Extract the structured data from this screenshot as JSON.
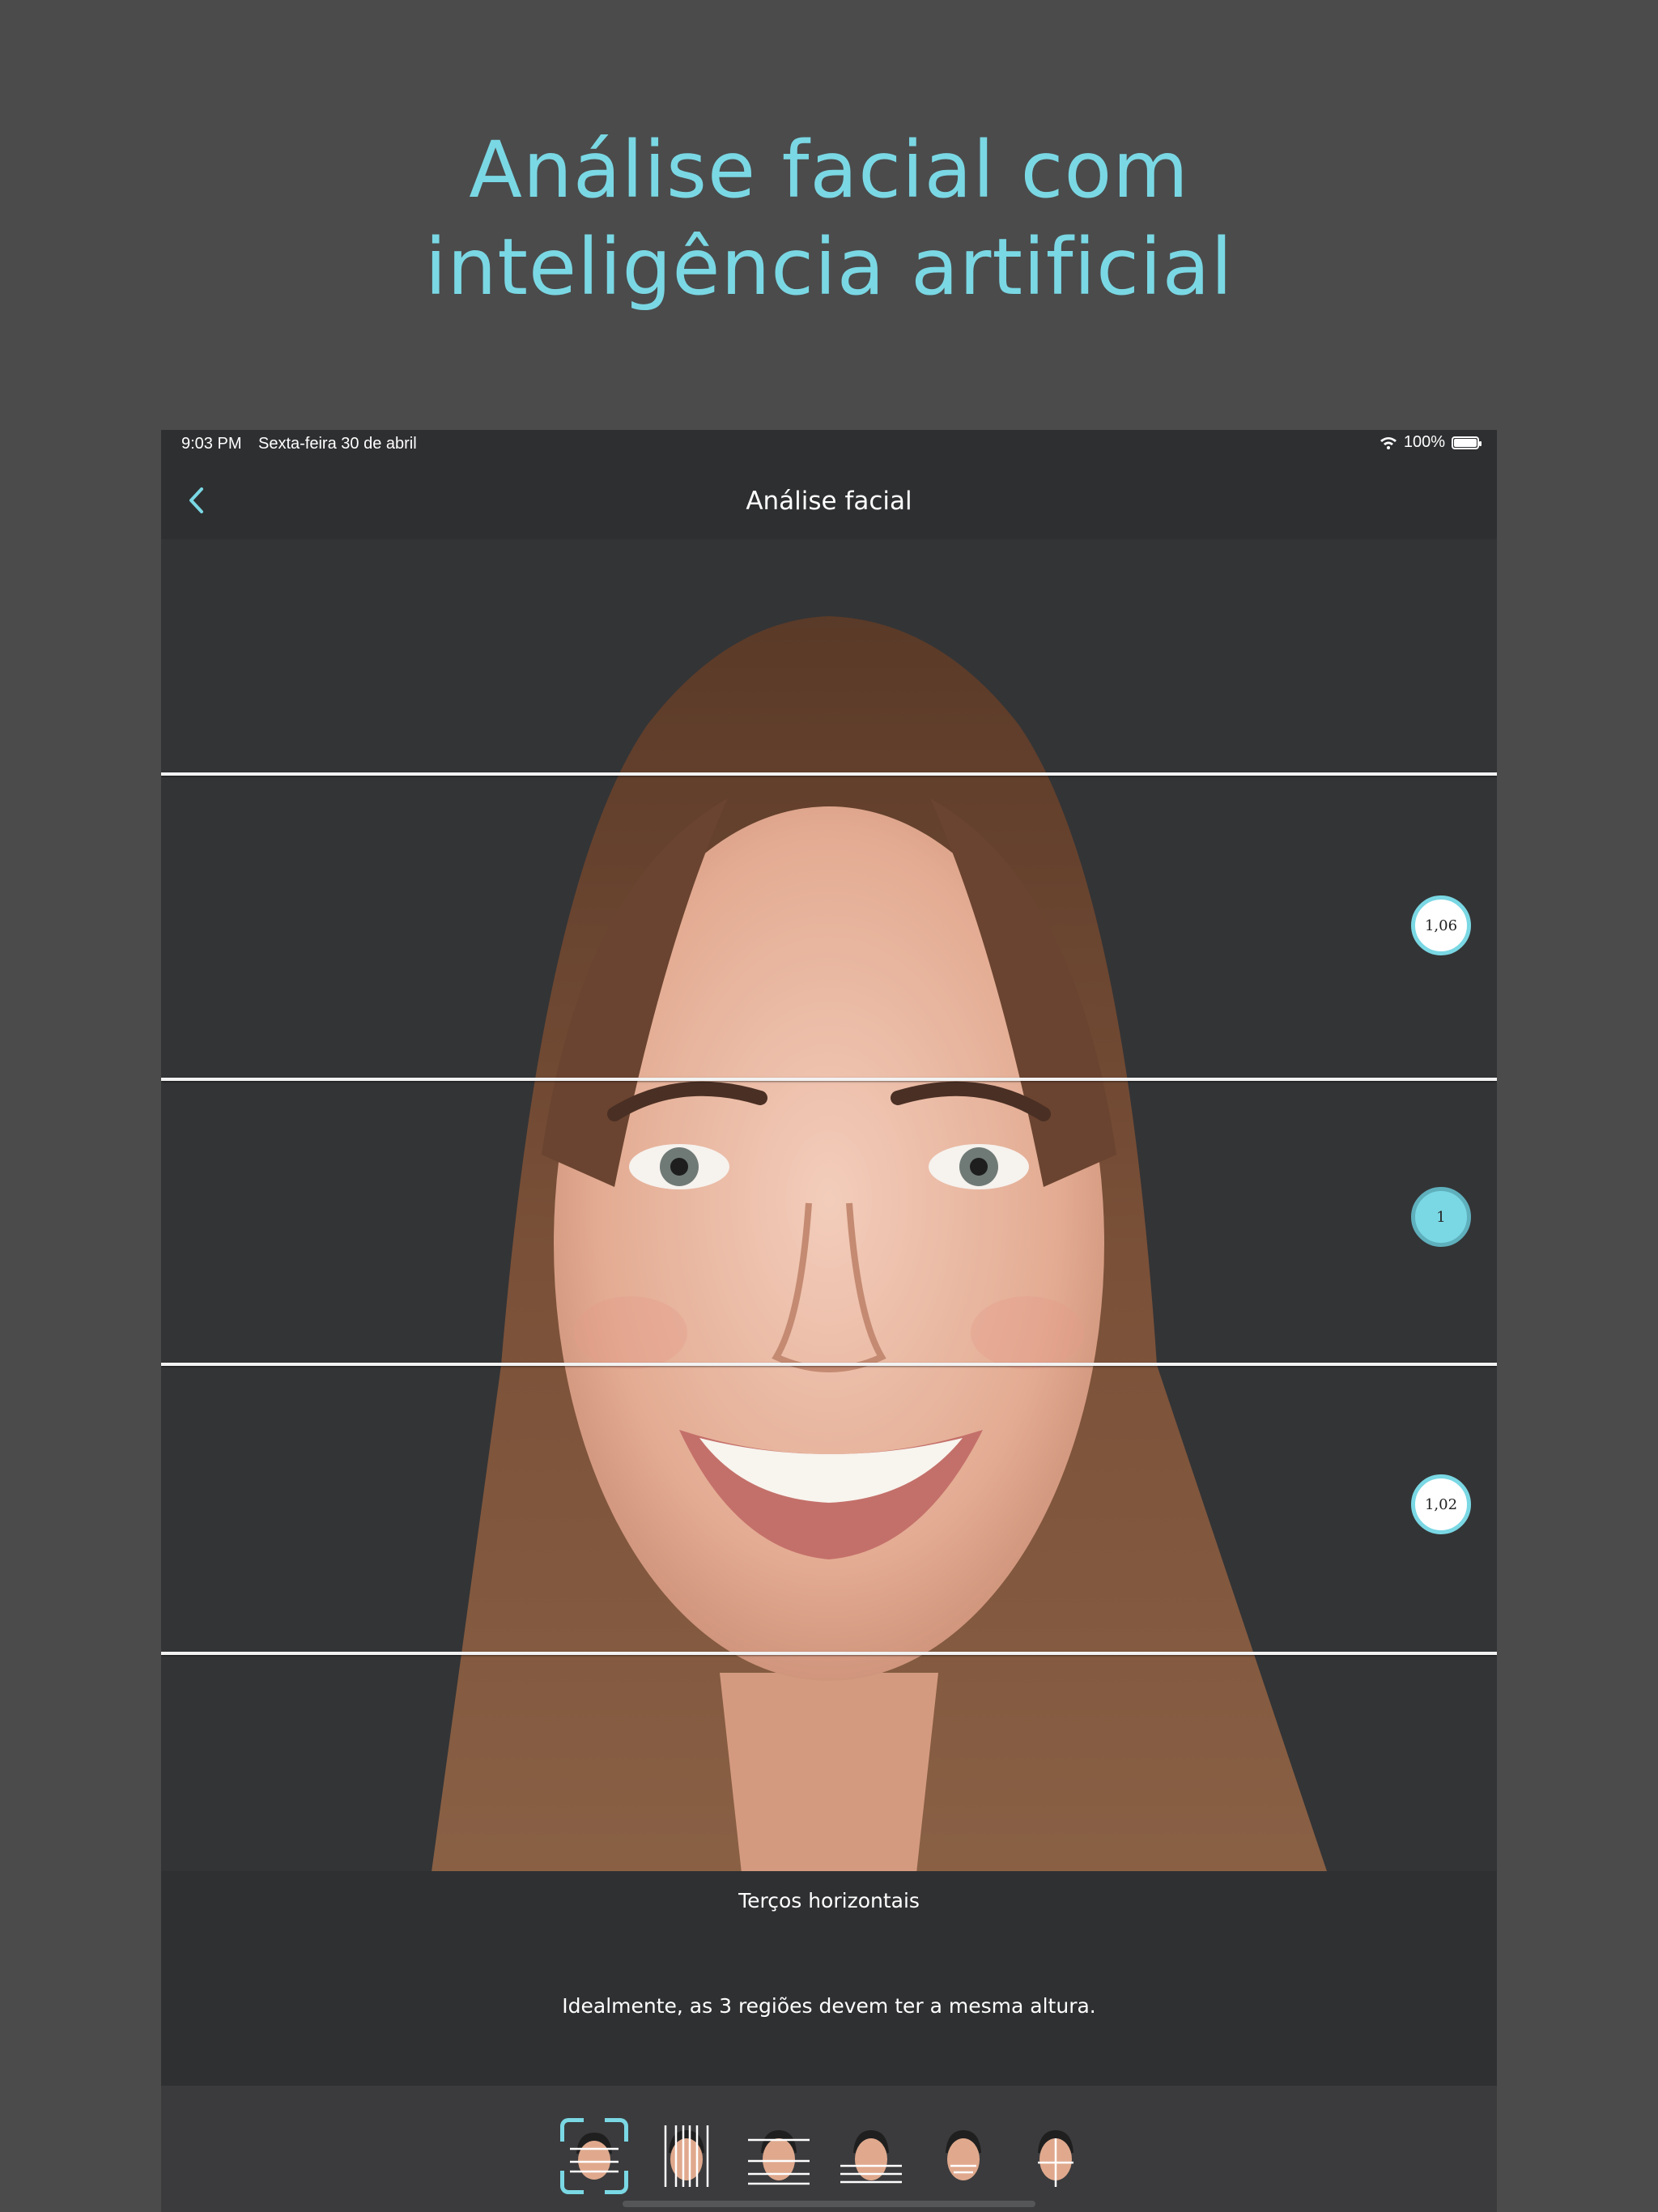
{
  "headline": {
    "line1": "Análise facial com",
    "line2": "inteligência artificial"
  },
  "status_bar": {
    "time": "9:03 PM",
    "date": "Sexta-feira 30 de abril",
    "battery": "100%"
  },
  "nav": {
    "title": "Análise facial",
    "back_icon": "chevron-left-icon"
  },
  "analysis": {
    "ratios": [
      "1,06",
      "1",
      "1,02"
    ]
  },
  "info": {
    "title": "Terços horizontais",
    "description": "Idealmente, as 3 regiões devem ter a mesma altura."
  },
  "toolbar": {
    "tools": [
      {
        "icon": "horizontal-thirds-icon",
        "selected": true
      },
      {
        "icon": "vertical-fifths-icon",
        "selected": false
      },
      {
        "icon": "horizontal-lines-icon",
        "selected": false
      },
      {
        "icon": "lower-third-icon",
        "selected": false
      },
      {
        "icon": "lips-ratio-icon",
        "selected": false
      },
      {
        "icon": "symmetry-axis-icon",
        "selected": false
      }
    ]
  },
  "colors": {
    "accent": "#7ad8e4",
    "background": "#4b4b4c",
    "panel": "#2f3032"
  }
}
